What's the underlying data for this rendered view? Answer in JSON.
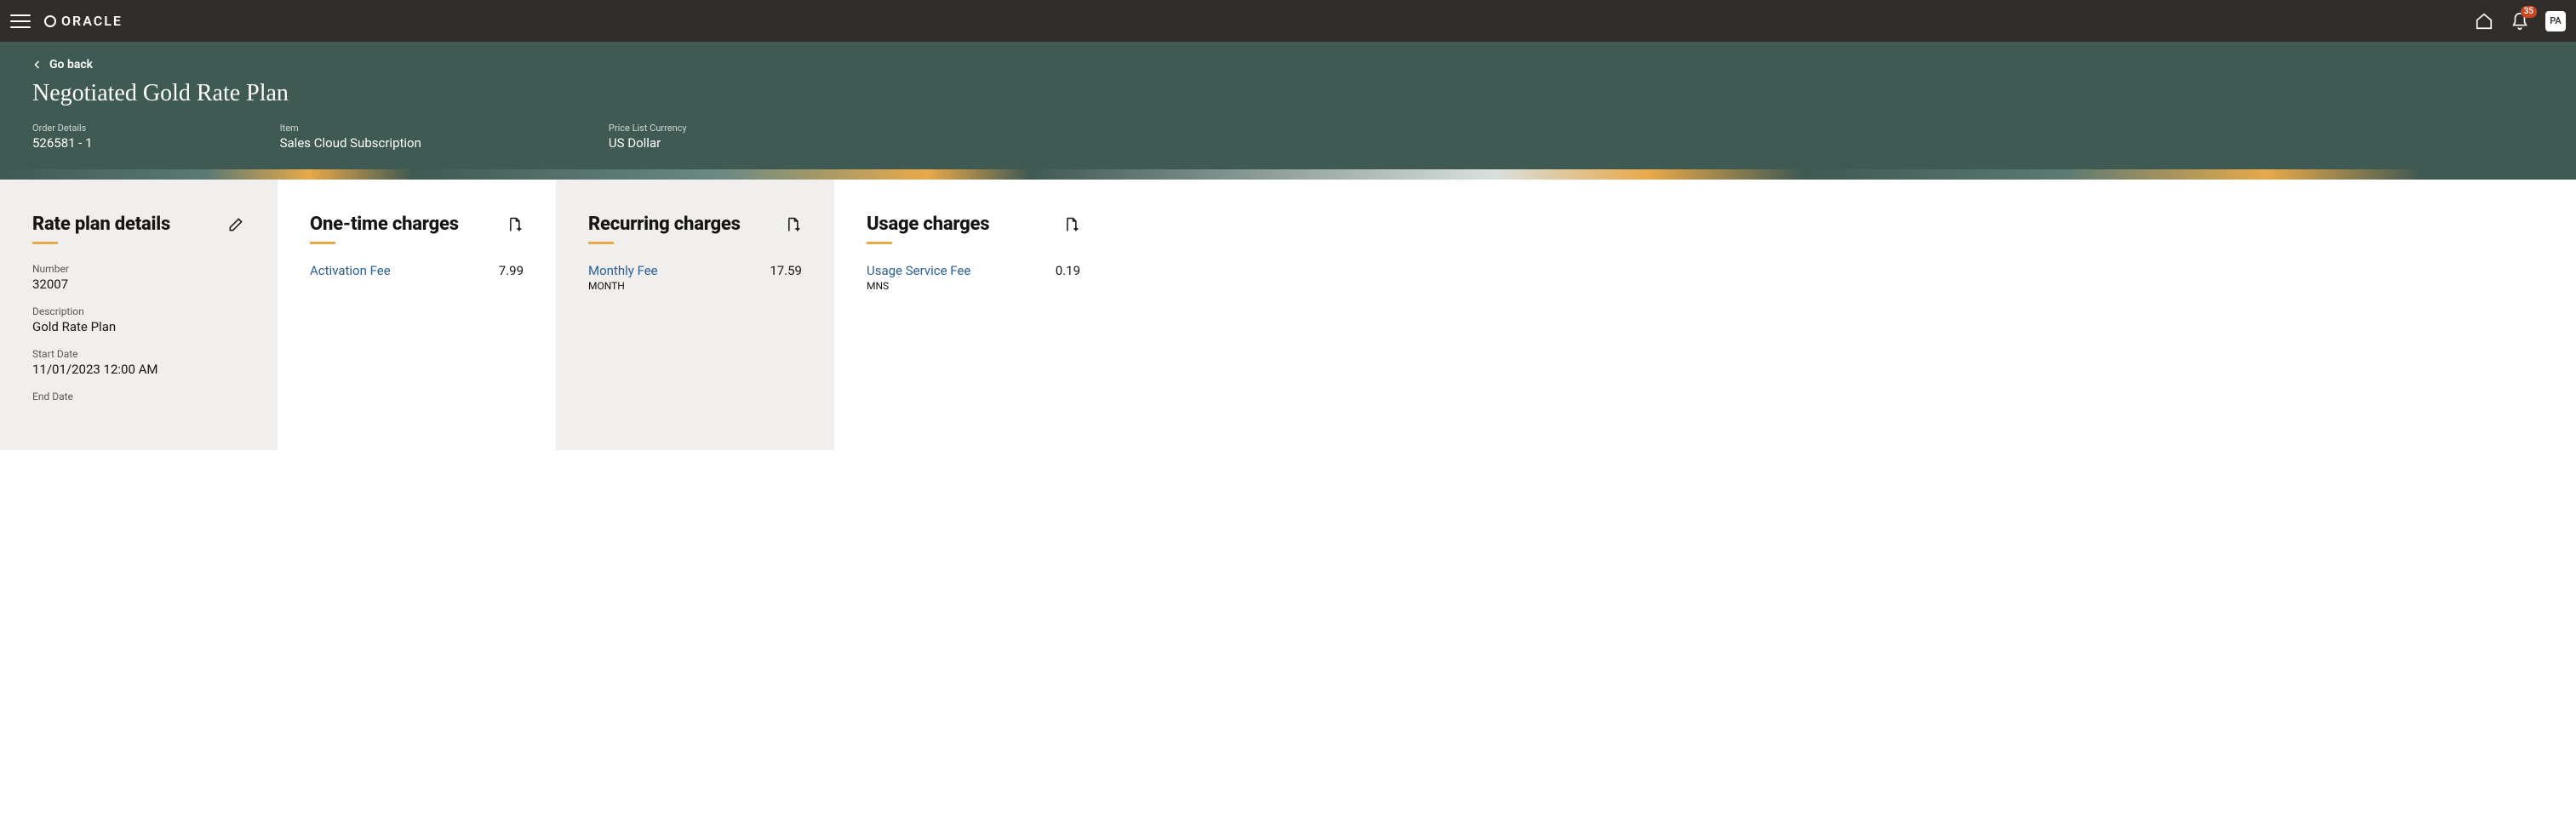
{
  "brand": "ORACLE",
  "notifications_count": "35",
  "avatar_initials": "PA",
  "go_back_label": "Go back",
  "page_title": "Negotiated Gold Rate Plan",
  "meta": {
    "order_details": {
      "label": "Order Details",
      "value": "526581 - 1"
    },
    "item": {
      "label": "Item",
      "value": "Sales Cloud Subscription"
    },
    "currency": {
      "label": "Price List Currency",
      "value": "US Dollar"
    }
  },
  "rate_plan_details": {
    "title": "Rate plan details",
    "number": {
      "label": "Number",
      "value": "32007"
    },
    "description": {
      "label": "Description",
      "value": "Gold Rate Plan"
    },
    "start_date": {
      "label": "Start Date",
      "value": "11/01/2023 12:00 AM"
    },
    "end_date": {
      "label": "End Date",
      "value": ""
    }
  },
  "one_time": {
    "title": "One-time charges",
    "item": {
      "name": "Activation Fee",
      "amount": "7.99"
    }
  },
  "recurring": {
    "title": "Recurring charges",
    "item": {
      "name": "Monthly Fee",
      "period": "MONTH",
      "amount": "17.59"
    }
  },
  "usage": {
    "title": "Usage charges",
    "item": {
      "name": "Usage Service Fee",
      "unit": "MNS",
      "amount": "0.19"
    }
  }
}
